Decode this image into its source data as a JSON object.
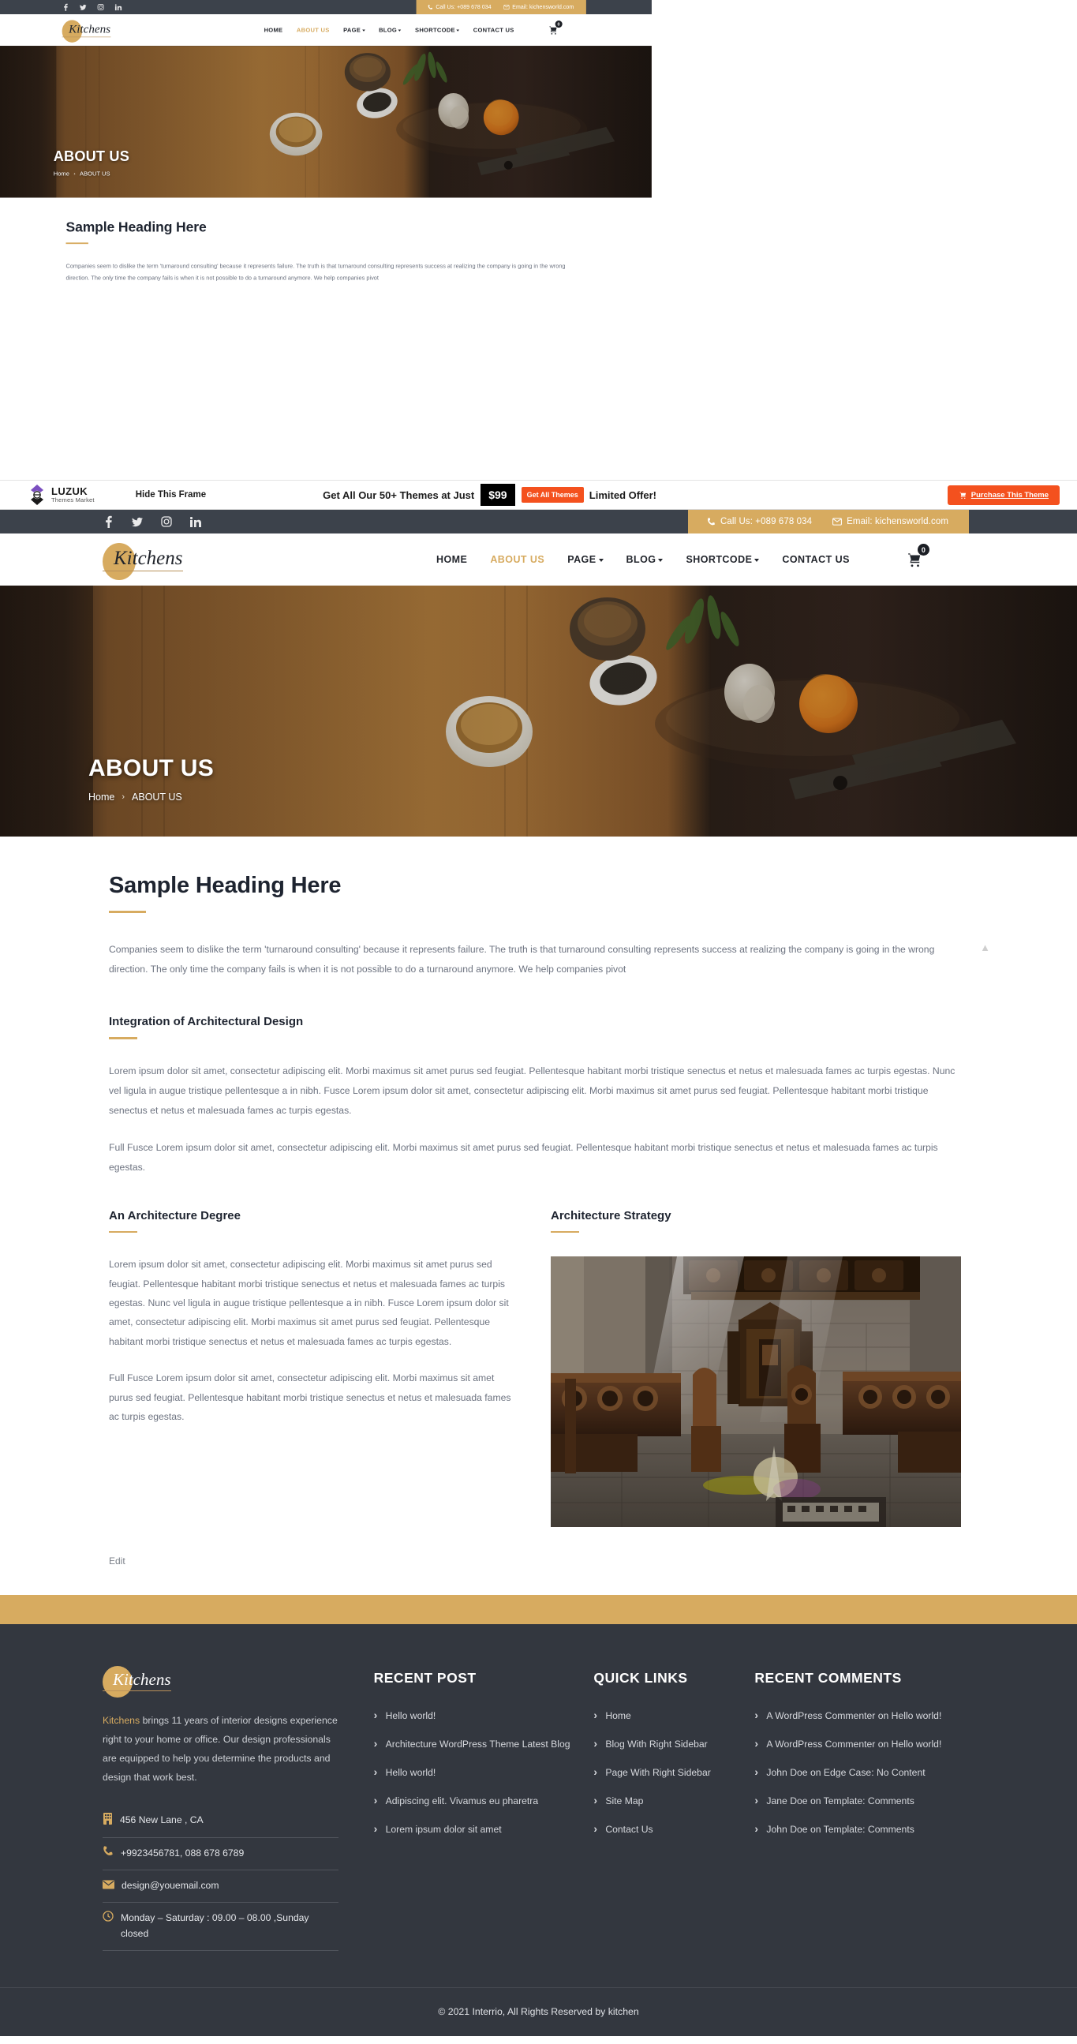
{
  "topbar": {
    "socials": [
      {
        "name": "facebook-icon",
        "label": "f"
      },
      {
        "name": "twitter-icon",
        "label": "t"
      },
      {
        "name": "instagram-icon",
        "label": "ig"
      },
      {
        "name": "linkedin-icon",
        "label": "in"
      }
    ],
    "phone_label": "Call Us: +089 678 034",
    "email_label": "Email: kichensworld.com",
    "bg_dark": "#3c424b",
    "bg_gold": "#d7ab60"
  },
  "nav": {
    "brand": "Kitchens",
    "items": [
      {
        "label": "HOME",
        "active": false,
        "dropdown": false
      },
      {
        "label": "ABOUT US",
        "active": true,
        "dropdown": false
      },
      {
        "label": "PAGE",
        "active": false,
        "dropdown": true
      },
      {
        "label": "BLOG",
        "active": false,
        "dropdown": true
      },
      {
        "label": "SHORTCODE",
        "active": false,
        "dropdown": true
      },
      {
        "label": "CONTACT US",
        "active": false,
        "dropdown": false
      }
    ],
    "cart_count": "0"
  },
  "hero": {
    "title": "ABOUT US",
    "breadcrumb_home": "Home",
    "breadcrumb_sep": "›",
    "breadcrumb_current": "ABOUT US"
  },
  "main": {
    "heading": "Sample Heading Here",
    "intro": "Companies seem to dislike the term 'turnaround consulting' because it represents failure. The truth is that turnaround consulting represents success at realizing the company is going in the wrong direction. The only time the company fails is when it is not possible to do a turnaround anymore. We help companies pivot",
    "section_title": "Integration of Architectural Design",
    "section_p1": "Lorem ipsum dolor sit amet, consectetur adipiscing elit. Morbi maximus sit amet purus sed feugiat. Pellentesque habitant morbi tristique senectus et netus et malesuada fames ac turpis egestas. Nunc vel ligula in augue tristique pellentesque a in nibh. Fusce Lorem ipsum dolor sit amet, consectetur adipiscing elit. Morbi maximus sit amet purus sed feugiat. Pellentesque habitant morbi tristique senectus et netus et malesuada fames ac turpis egestas.",
    "section_p2": "Full Fusce Lorem ipsum dolor sit amet, consectetur adipiscing elit. Morbi maximus sit amet purus sed feugiat. Pellentesque habitant morbi tristique senectus et netus et malesuada fames ac turpis egestas.",
    "col_left_title": "An Architecture Degree",
    "col_left_p1": "Lorem ipsum dolor sit amet, consectetur adipiscing elit. Morbi maximus sit amet purus sed feugiat. Pellentesque habitant morbi tristique senectus et netus et malesuada fames ac turpis egestas. Nunc vel ligula in augue tristique pellentesque a in nibh. Fusce Lorem ipsum dolor sit amet, consectetur adipiscing elit. Morbi maximus sit amet purus sed feugiat. Pellentesque habitant morbi tristique senectus et netus et malesuada fames ac turpis egestas.",
    "col_left_p2": "Full Fusce Lorem ipsum dolor sit amet, consectetur adipiscing elit. Morbi maximus sit amet purus sed feugiat. Pellentesque habitant morbi tristique senectus et netus et malesuada fames ac turpis egestas.",
    "col_right_title": "Architecture Strategy",
    "edit_label": "Edit",
    "accent_color": "#d7ab60"
  },
  "luzuk": {
    "brand_name": "LUZUK",
    "brand_sub": "Themes Market",
    "hide_label": "Hide This Frame",
    "offer_text": "Get All Our 50+ Themes at Just",
    "price": "$99",
    "get_all_label": "Get All Themes",
    "limited_label": "Limited Offer!",
    "purchase_label": "Purchase This Theme"
  },
  "footer": {
    "brand": "Kitchens",
    "about_brand": "Kitchens",
    "about_rest": " brings 11 years of interior designs experience right to your home or office. Our design professionals are equipped to help you determine the products and design that work best.",
    "info": [
      {
        "icon": "building-icon",
        "text": "456 New Lane , CA"
      },
      {
        "icon": "phone-icon",
        "text": "+9923456781, 088 678 6789"
      },
      {
        "icon": "mail-icon",
        "text": "design@youemail.com"
      },
      {
        "icon": "clock-icon",
        "text": "Monday – Saturday : 09.00 – 08.00 ,Sunday closed"
      }
    ],
    "recent_post_title": "RECENT POST",
    "recent_posts": [
      "Hello world!",
      "Architecture WordPress Theme Latest Blog",
      "Hello world!",
      "Adipiscing elit. Vivamus eu pharetra",
      "Lorem ipsum dolor sit amet"
    ],
    "quick_links_title": "QUICK LINKS",
    "quick_links": [
      "Home",
      "Blog With Right Sidebar",
      "Page With Right Sidebar",
      "Site Map",
      "Contact Us"
    ],
    "recent_comments_title": "RECENT COMMENTS",
    "recent_comments": [
      "A WordPress Commenter on Hello world!",
      "A WordPress Commenter on Hello world!",
      "John Doe on Edge Case: No Content",
      "Jane Doe on Template: Comments",
      "John Doe on Template: Comments"
    ],
    "copyright": "© 2021 Interrio, All Rights Reserved by kitchen"
  }
}
